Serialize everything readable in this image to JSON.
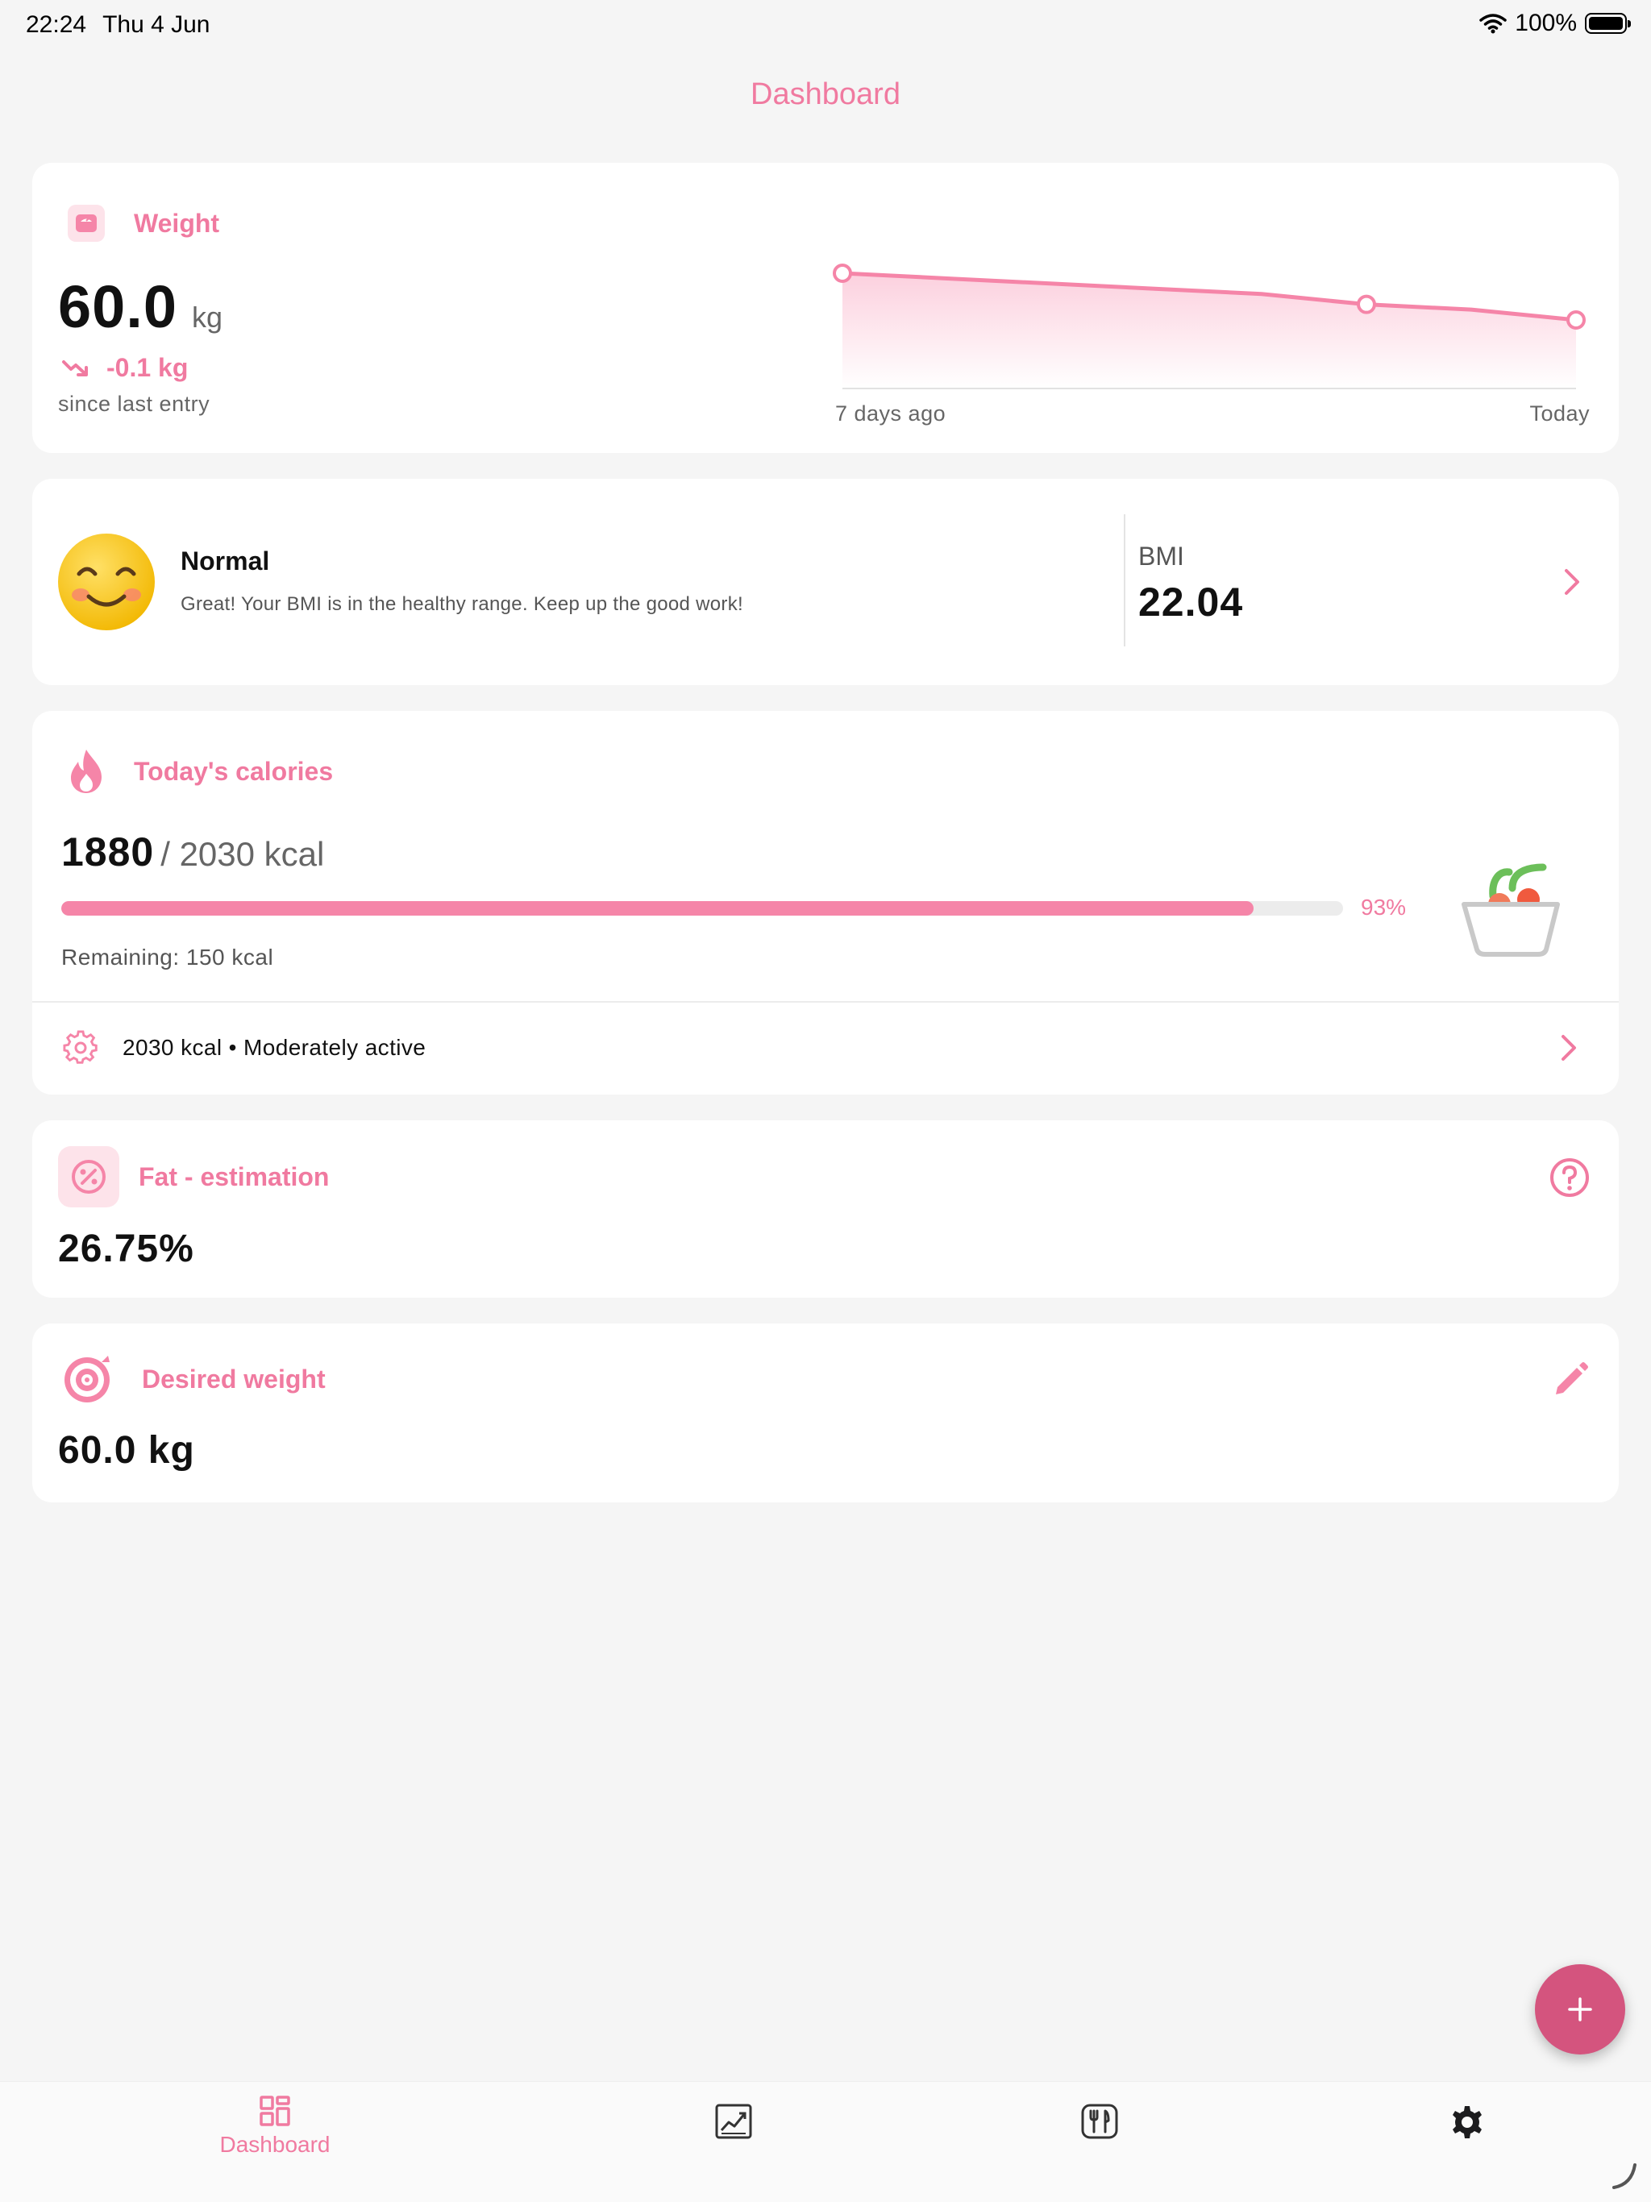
{
  "status_bar": {
    "time": "22:24",
    "date": "Thu 4 Jun",
    "battery": "100%"
  },
  "nav": {
    "title": "Dashboard"
  },
  "weight": {
    "label": "Weight",
    "value": "60.0",
    "unit": "kg",
    "delta": "-0.1 kg",
    "delta_note": "since last entry",
    "chart_start_label": "7 days ago",
    "chart_end_label": "Today"
  },
  "chart_data": {
    "type": "area",
    "title": "",
    "x": [
      "7 days ago",
      "",
      "",
      "",
      "",
      "",
      "",
      "Today"
    ],
    "series": [
      {
        "values": [
          60.9,
          60.8,
          60.7,
          60.6,
          60.5,
          60.3,
          60.2,
          60.0
        ]
      }
    ],
    "marked_points": [
      0,
      5,
      7
    ],
    "grid": false,
    "colors": {
      "line": "#f585a8",
      "fill": "#fde3ea"
    }
  },
  "bmi": {
    "status": "Normal",
    "message": "Great! Your BMI is in the healthy range. Keep up the good work!",
    "label": "BMI",
    "value": "22.04"
  },
  "calories": {
    "label": "Today's calories",
    "consumed": "1880",
    "goal": "/ 2030 kcal",
    "progress_percent": 93,
    "percent_text": "93%",
    "remaining": "Remaining: 150 kcal",
    "settings_text": "2030 kcal • Moderately active"
  },
  "fat": {
    "label": "Fat - estimation",
    "value": "26.75%"
  },
  "desired_weight": {
    "label": "Desired weight",
    "value": "60.0 kg"
  },
  "tabs": [
    {
      "label": "Dashboard",
      "icon": "dashboard-icon",
      "active": true
    },
    {
      "label": "",
      "icon": "chart-icon",
      "active": false
    },
    {
      "label": "",
      "icon": "meals-icon",
      "active": false
    },
    {
      "label": "",
      "icon": "gear-icon",
      "active": false
    }
  ],
  "colors": {
    "accent": "#f07aa0",
    "fab": "#d4547e",
    "background": "#f5f5f5"
  }
}
